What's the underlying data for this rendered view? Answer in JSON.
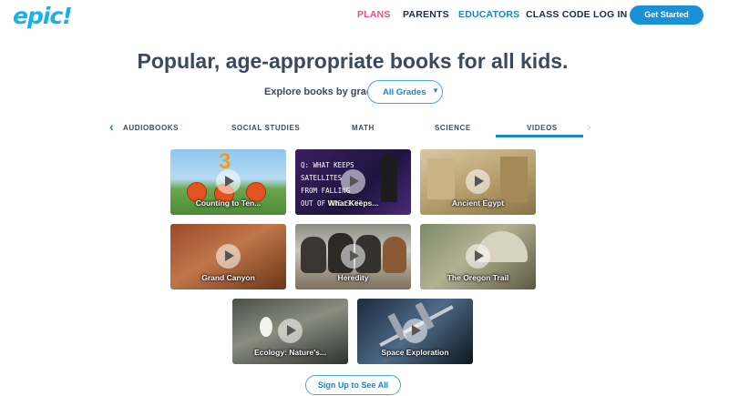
{
  "header": {
    "logo": "epic!",
    "nav": {
      "plans": "PLANS",
      "parents": "PARENTS",
      "educators": "EDUCATORS",
      "class_code": "CLASS CODE",
      "login": "LOG IN"
    },
    "cta": "Get Started"
  },
  "headline": "Popular, age-appropriate books for all kids.",
  "grade_filter": {
    "label": "Explore books by grade:",
    "selected": "All Grades"
  },
  "tabs": [
    {
      "label": "AUDIOBOOKS",
      "active": false
    },
    {
      "label": "SOCIAL STUDIES",
      "active": false
    },
    {
      "label": "MATH",
      "active": false
    },
    {
      "label": "SCIENCE",
      "active": false
    },
    {
      "label": "VIDEOS",
      "active": true
    }
  ],
  "videos": [
    {
      "title": "Counting to Ten..."
    },
    {
      "title": "What Keeps..."
    },
    {
      "title": "Ancient Egypt"
    },
    {
      "title": "Grand Canyon"
    },
    {
      "title": "Heredity"
    },
    {
      "title": "The Oregon Trail"
    },
    {
      "title": "Ecology: Nature's..."
    },
    {
      "title": "Space Exploration"
    }
  ],
  "thumbnail_text": {
    "counting_digit": "3",
    "what_keeps_caption": "Q: WHAT KEEPS\nSATELLITES\nFROM FALLING\nOUT OF THE SKY?"
  },
  "signup_button": "Sign Up to See All",
  "colors": {
    "brand": "#1ab0e8",
    "accent_pink": "#e94f8a",
    "primary_blue": "#1a90d9"
  }
}
